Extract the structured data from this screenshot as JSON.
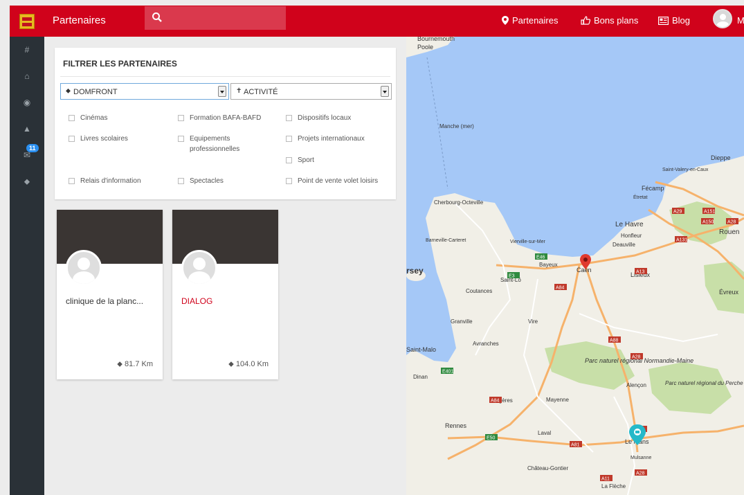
{
  "header": {
    "title": "Partenaires",
    "search_placeholder": "",
    "nav": [
      {
        "label": "Partenaires",
        "icon": "map-marker-icon"
      },
      {
        "label": "Bons plans",
        "icon": "thumbs-up-icon"
      },
      {
        "label": "Blog",
        "icon": "newspaper-icon"
      }
    ],
    "user_initial": "M"
  },
  "sidebar": {
    "items": [
      {
        "icon": "hashtag-icon",
        "glyph": "#"
      },
      {
        "icon": "home-icon",
        "glyph": "⌂"
      },
      {
        "icon": "user-circle-icon",
        "glyph": "◉"
      },
      {
        "icon": "bell-icon",
        "glyph": "▲"
      },
      {
        "icon": "envelope-icon",
        "glyph": "✉",
        "badge": "11"
      },
      {
        "icon": "map-marker-icon",
        "glyph": "⬥"
      }
    ]
  },
  "filter": {
    "title": "FILTRER LES PARTENAIRES",
    "location_select": "DOMFRONT",
    "activity_select": "ACTIVITÉ",
    "checkboxes": [
      "Cinémas",
      "Formation BAFA-BAFD",
      "Dispositifs locaux",
      "Livres scolaires",
      "Equipements professionnelles",
      "Projets internationaux",
      "Sport",
      "Relais d'information",
      "Spectacles",
      "Point de vente volet loisirs"
    ]
  },
  "cards": [
    {
      "name": "clinique de la planc...",
      "distance": "81.7 Km"
    },
    {
      "name": "DIALOG",
      "distance": "104.0 Km"
    }
  ],
  "map": {
    "labels": [
      "Bournemouth",
      "Poole",
      "Manche (mer)",
      "Cherbourg-Octeville",
      "Barneville-Carteret",
      "Vierville-sur-Mer",
      "rsey",
      "Bayeux",
      "Caen",
      "Saint-Lô",
      "Coutances",
      "Granville",
      "Vire",
      "Avranches",
      "Saint-Malo",
      "Dinan",
      "Fougères",
      "Mayenne",
      "Rennes",
      "Laval",
      "Château-Gontier",
      "La Flèche",
      "Le Mans",
      "Mulsanne",
      "Alençon",
      "Parc naturel régional Normandie-Maine",
      "Parc naturel régional du Perche",
      "Le Havre",
      "Honfleur",
      "Deauville",
      "Lisieux",
      "Rouen",
      "Évreux",
      "Fécamp",
      "Étretat",
      "Dieppe",
      "Saint-Valery-en-Caux"
    ],
    "roads": [
      "A29",
      "A151",
      "A150",
      "A28",
      "A131",
      "A13",
      "A84",
      "E46",
      "E3",
      "A88",
      "A28",
      "E401",
      "A84",
      "E50",
      "A81",
      "A11",
      "A11",
      "A28"
    ],
    "colors": {
      "sea": "#a5c8f7",
      "land": "#f1efe7",
      "forest": "#c8dfa8",
      "motorway": "#f6b26b",
      "road": "#ffffff",
      "marker_red": "#e03a2f",
      "marker_teal": "#25b9c9"
    }
  }
}
